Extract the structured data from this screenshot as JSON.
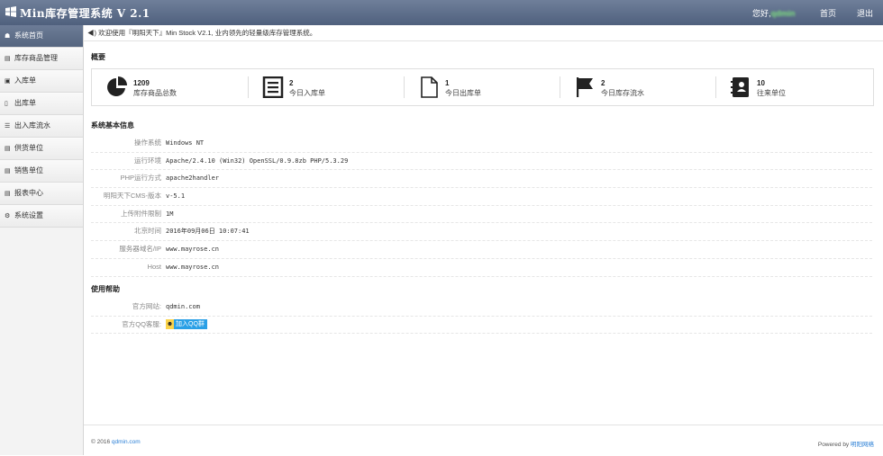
{
  "header": {
    "title": "Min库存管理系统 V 2.1",
    "greeting": "您好,",
    "user": "qdmin",
    "home_label": "首页",
    "logout_label": "退出"
  },
  "sidebar": {
    "items": [
      {
        "label": "系统首页",
        "icon": "home-icon"
      },
      {
        "label": "库存商品管理",
        "icon": "list-icon"
      },
      {
        "label": "入库单",
        "icon": "inbox-icon"
      },
      {
        "label": "出库单",
        "icon": "document-icon"
      },
      {
        "label": "出入库流水",
        "icon": "list-icon"
      },
      {
        "label": "供货单位",
        "icon": "list-icon"
      },
      {
        "label": "销售单位",
        "icon": "list-icon"
      },
      {
        "label": "报表中心",
        "icon": "report-icon"
      },
      {
        "label": "系统设置",
        "icon": "gear-icon"
      }
    ]
  },
  "notice": "欢迎使用『明阳天下』Min Stock V2.1, 业内领先的轻量级库存管理系统。",
  "overview": {
    "title": "概要",
    "stats": [
      {
        "value": "1209",
        "label": "库存商品总数",
        "icon": "pie-chart-icon"
      },
      {
        "value": "2",
        "label": "今日入库单",
        "icon": "list-doc-icon"
      },
      {
        "value": "1",
        "label": "今日出库单",
        "icon": "blank-doc-icon"
      },
      {
        "value": "2",
        "label": "今日库存流水",
        "icon": "flag-icon"
      },
      {
        "value": "10",
        "label": "往来单位",
        "icon": "contacts-icon"
      }
    ]
  },
  "sysinfo": {
    "title": "系统基本信息",
    "rows": [
      {
        "key": "操作系统",
        "value": "Windows NT"
      },
      {
        "key": "运行环境",
        "value": "Apache/2.4.10 (Win32) OpenSSL/0.9.8zb PHP/5.3.29"
      },
      {
        "key": "PHP运行方式",
        "value": "apache2handler"
      },
      {
        "key": "明阳天下CMS-版本",
        "value": "v-5.1"
      },
      {
        "key": "上传附件限制",
        "value": "1M"
      },
      {
        "key": "北京时间",
        "value": "2016年09月06日 10:07:41"
      },
      {
        "key": "服务器域名/IP",
        "value": "www.mayrose.cn"
      },
      {
        "key": "Host",
        "value": "www.mayrose.cn"
      }
    ]
  },
  "help": {
    "title": "使用帮助",
    "site_key": "官方网站:",
    "site_value": "qdmin.com",
    "qq_key": "官方QQ客服:",
    "qq_button": "加入QQ群"
  },
  "footer": {
    "copyright": "© 2016 ",
    "copyright_link": "qdmin.com",
    "powered": "Powered by ",
    "powered_link": "明阳网络"
  }
}
